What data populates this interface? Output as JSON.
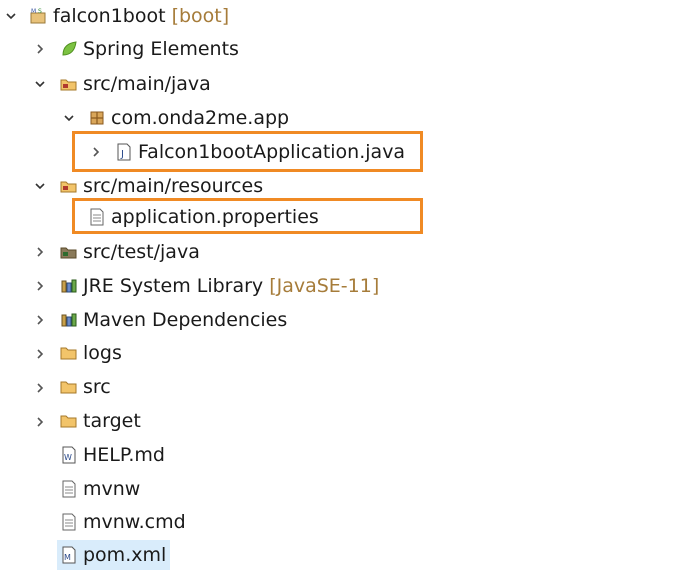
{
  "tree": {
    "project": {
      "label": "falcon1boot",
      "decoration": "[boot]",
      "icon": "maven-project-icon"
    },
    "spring_elements": {
      "label": "Spring Elements",
      "icon": "spring-leaf-icon"
    },
    "src_main_java": {
      "label": "src/main/java",
      "icon": "source-folder-icon"
    },
    "package": {
      "label": "com.onda2me.app",
      "icon": "package-icon"
    },
    "app_class": {
      "label": "Falcon1bootApplication.java",
      "icon": "java-file-icon"
    },
    "src_main_resources": {
      "label": "src/main/resources",
      "icon": "source-folder-icon"
    },
    "app_properties": {
      "label": "application.properties",
      "icon": "properties-file-icon"
    },
    "src_test_java": {
      "label": "src/test/java",
      "icon": "test-source-folder-icon"
    },
    "jre": {
      "label": "JRE System Library",
      "decoration": "[JavaSE-11]",
      "icon": "library-icon"
    },
    "maven_deps": {
      "label": "Maven Dependencies",
      "icon": "library-icon"
    },
    "logs": {
      "label": "logs",
      "icon": "folder-icon"
    },
    "src": {
      "label": "src",
      "icon": "folder-icon"
    },
    "target": {
      "label": "target",
      "icon": "folder-icon"
    },
    "help": {
      "label": "HELP.md",
      "icon": "markdown-file-icon"
    },
    "mvnw": {
      "label": "mvnw",
      "icon": "text-file-icon"
    },
    "mvnw_cmd": {
      "label": "mvnw.cmd",
      "icon": "text-file-icon"
    },
    "pom": {
      "label": "pom.xml",
      "icon": "maven-pom-icon"
    }
  },
  "colors": {
    "highlight_box": "#f08a24",
    "selection": "#d9ecfb",
    "decoration_text": "#a67c3a"
  }
}
